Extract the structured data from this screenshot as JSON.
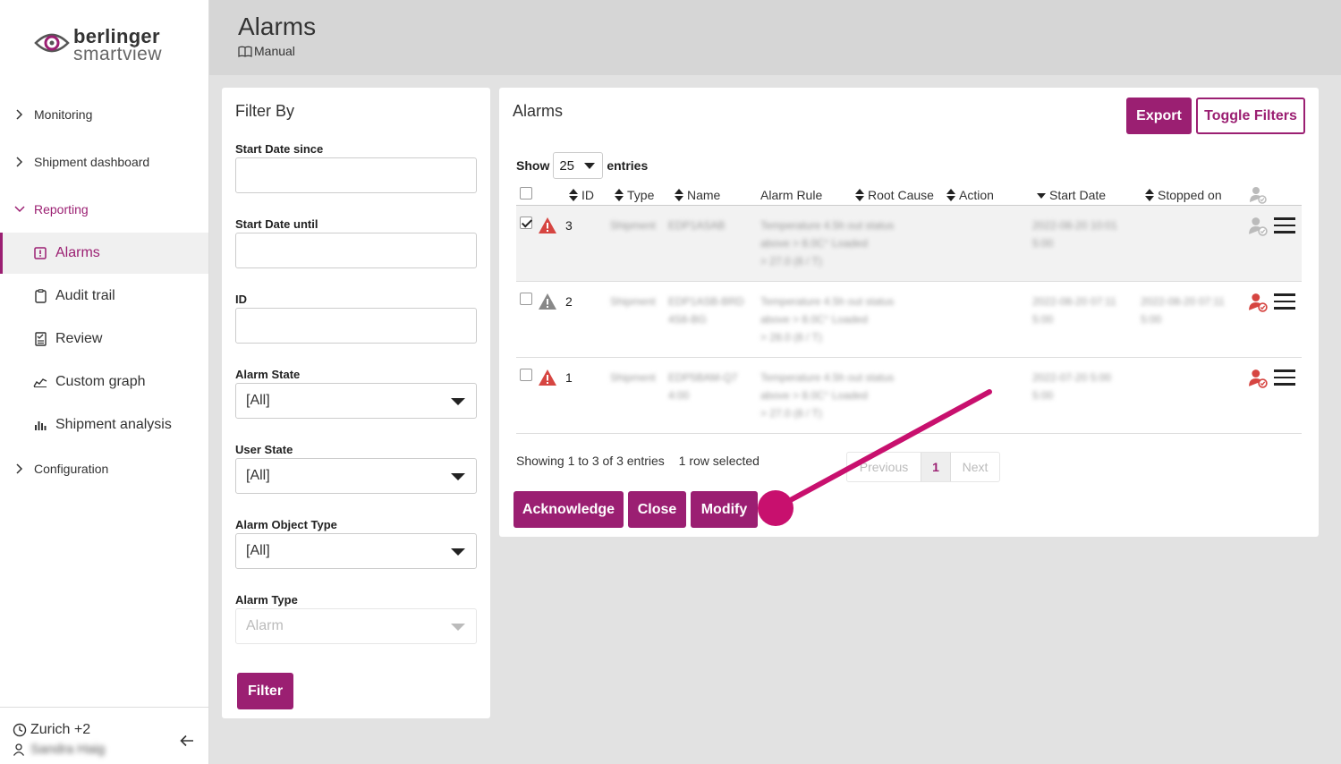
{
  "colors": {
    "accent": "#9b1f72",
    "warning": "#d64541",
    "warning_gray": "#888888",
    "pointer": "#c8106e"
  },
  "logo": {
    "line1": "berlinger",
    "line2": "smartview"
  },
  "sidebar": {
    "items": [
      {
        "label": "Monitoring",
        "icon": "chevron-right-icon"
      },
      {
        "label": "Shipment dashboard",
        "icon": "chevron-right-icon"
      },
      {
        "label": "Reporting",
        "icon": "chevron-down-icon"
      },
      {
        "label": "Configuration",
        "icon": "chevron-right-icon"
      }
    ],
    "sub_items": [
      {
        "label": "Alarms",
        "icon": "alarm-icon"
      },
      {
        "label": "Audit trail",
        "icon": "clipboard-icon"
      },
      {
        "label": "Review",
        "icon": "review-icon"
      },
      {
        "label": "Custom graph",
        "icon": "graph-icon"
      },
      {
        "label": "Shipment analysis",
        "icon": "bar-chart-icon"
      }
    ],
    "timezone": "Zurich +2",
    "user": "Sandra Haig"
  },
  "header": {
    "title": "Alarms",
    "manual": "Manual"
  },
  "filter": {
    "title": "Filter By",
    "start_since_label": "Start Date since",
    "start_until_label": "Start Date until",
    "id_label": "ID",
    "alarm_state_label": "Alarm State",
    "alarm_state_value": "[All]",
    "user_state_label": "User State",
    "user_state_value": "[All]",
    "object_type_label": "Alarm Object Type",
    "object_type_value": "[All]",
    "alarm_type_label": "Alarm Type",
    "alarm_type_value": "Alarm",
    "filter_button": "Filter"
  },
  "alarms": {
    "title": "Alarms",
    "export_button": "Export",
    "toggle_button": "Toggle Filters",
    "show_label": "Show",
    "page_length": "25",
    "entries_label": "entries",
    "columns": [
      "ID",
      "Type",
      "Name",
      "Alarm Rule",
      "Root Cause",
      "Action",
      "Start Date",
      "Stopped on"
    ],
    "rows": [
      {
        "id": "3",
        "checked": true,
        "type": "Shipment",
        "name": "EDP1ASAB",
        "rule": [
          "Temperature 4.5h out status",
          "above > 8.0C° Loaded",
          "> 27.0 (8 / T)"
        ],
        "start": [
          "2022-08-20 10:01",
          "5:00"
        ],
        "stopped": "",
        "level": "red"
      },
      {
        "id": "2",
        "checked": false,
        "type": "Shipment",
        "name": "EDP1ASB-BRD 4S8-BG",
        "rule": [
          "Temperature 4.5h out status",
          "above > 8.0C° Loaded",
          "> 28.0 (8 / T)"
        ],
        "start": [
          "2022-08-20 07:11",
          "5:00"
        ],
        "stopped": "2022-08-20 07:11 5:00",
        "level": "gray"
      },
      {
        "id": "1",
        "checked": false,
        "type": "Shipment",
        "name": "EDP5BAM-Q7 4:00",
        "rule": [
          "Temperature 4.5h out status",
          "above > 8.0C° Loaded",
          "> 27.0 (8 / T)"
        ],
        "start": [
          "2022-07-20 5:00",
          "5:00"
        ],
        "stopped": "",
        "level": "red"
      }
    ],
    "info": "Showing 1 to 3 of 3 entries",
    "selected_info": "1 row selected",
    "prev": "Previous",
    "page": "1",
    "next": "Next",
    "acknowledge_button": "Acknowledge",
    "close_button": "Close",
    "modify_button": "Modify"
  }
}
